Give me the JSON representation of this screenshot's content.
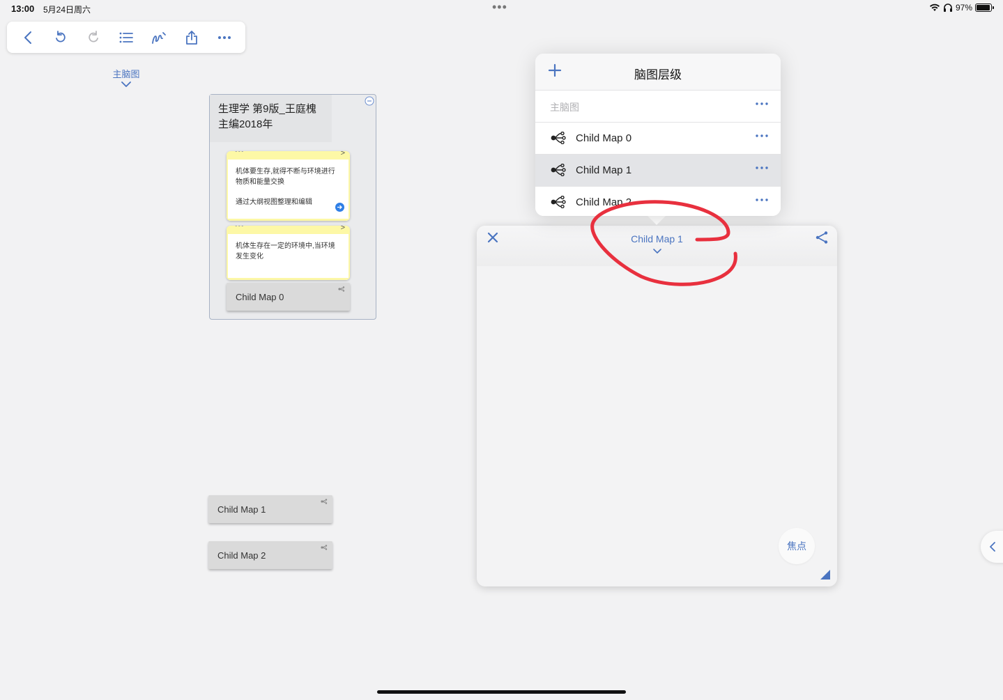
{
  "status_bar": {
    "time": "13:00",
    "date": "5月24日周六",
    "center_dots": "•••",
    "battery": "97%"
  },
  "toolbar": {
    "buttons": [
      {
        "name": "back",
        "icon": "chevron-left-icon"
      },
      {
        "name": "undo",
        "icon": "undo-icon"
      },
      {
        "name": "redo",
        "icon": "redo-icon"
      },
      {
        "name": "outline",
        "icon": "list-icon"
      },
      {
        "name": "draw",
        "icon": "pen-scribble-icon"
      },
      {
        "name": "share",
        "icon": "share-icon"
      },
      {
        "name": "more",
        "icon": "more-icon"
      }
    ]
  },
  "main_map": {
    "label": "主脑图"
  },
  "canvas": {
    "root_title": "生理学 第9版_王庭槐主编2018年",
    "notes": [
      {
        "text": "机体要生存,就得不断与环境进行物质和能量交换",
        "subtext": "通过大纲视图整理和编辑"
      },
      {
        "text": "机体生存在一定的环境中,当环境发生变化",
        "subtext": ""
      }
    ],
    "child_nodes": [
      "Child Map 0",
      "Child Map 1",
      "Child Map 2"
    ]
  },
  "hierarchy_popover": {
    "title": "脑图层级",
    "root_item": "主脑图",
    "items": [
      {
        "label": "Child Map 0",
        "selected": false
      },
      {
        "label": "Child Map 1",
        "selected": true
      },
      {
        "label": "Child Map 2",
        "selected": false
      }
    ]
  },
  "child_panel": {
    "title": "Child Map 1",
    "focus_label": "焦点"
  },
  "colors": {
    "accent": "#4a74c0",
    "note_yellow": "#fdf8a6",
    "annotation_red": "#e8303e",
    "background": "#f2f2f3"
  }
}
